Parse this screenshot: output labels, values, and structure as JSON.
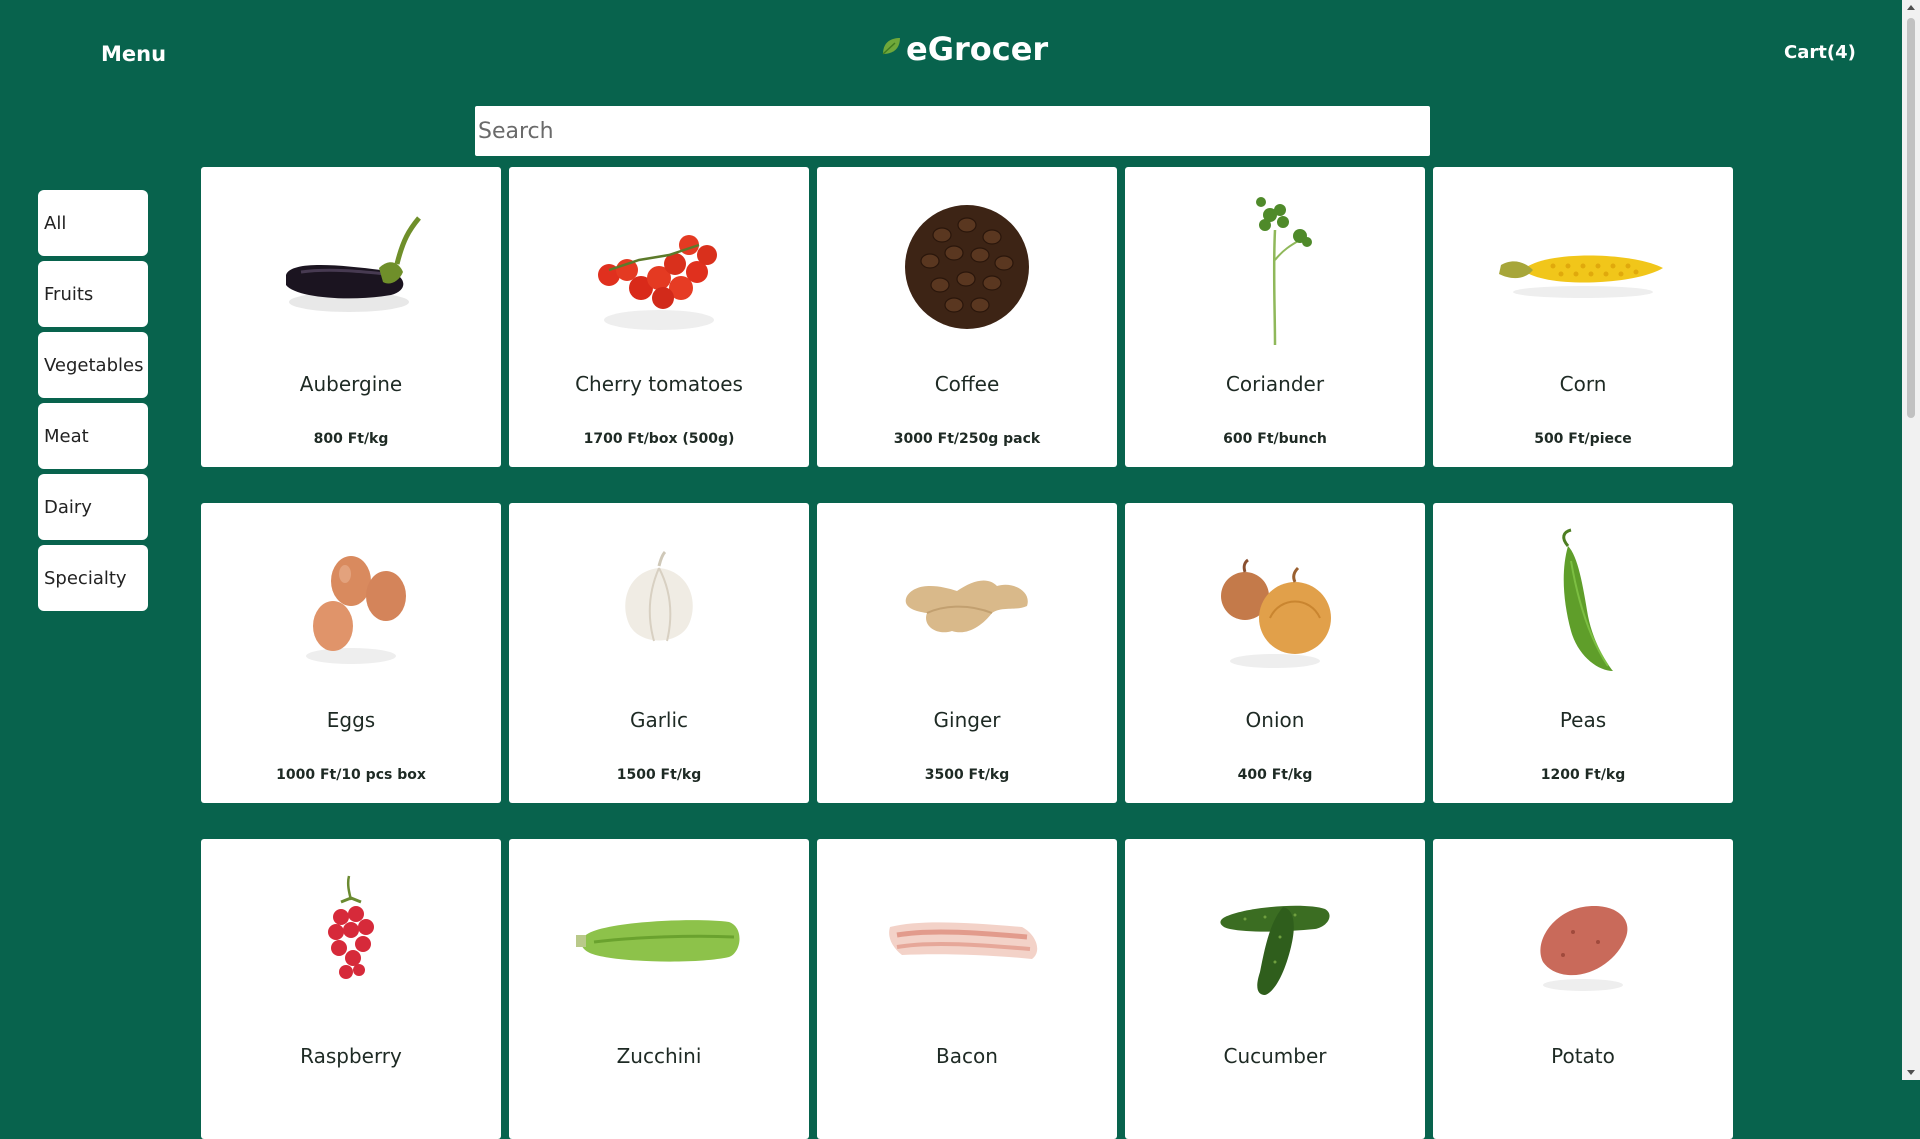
{
  "header": {
    "menu_label": "Menu",
    "logo_text": "eGrocer",
    "cart_label": "Cart(4)"
  },
  "search": {
    "placeholder": "Search",
    "value": ""
  },
  "categories": [
    "All",
    "Fruits",
    "Vegetables",
    "Meat",
    "Dairy",
    "Specialty"
  ],
  "products": [
    {
      "name": "Aubergine",
      "price": "800 Ft/kg",
      "icon": "aubergine-image"
    },
    {
      "name": "Cherry tomatoes",
      "price": "1700 Ft/box (500g)",
      "icon": "cherry-tomatoes-image"
    },
    {
      "name": "Coffee",
      "price": "3000 Ft/250g pack",
      "icon": "coffee-beans-image"
    },
    {
      "name": "Coriander",
      "price": "600 Ft/bunch",
      "icon": "coriander-image"
    },
    {
      "name": "Corn",
      "price": "500 Ft/piece",
      "icon": "corn-image"
    },
    {
      "name": "Eggs",
      "price": "1000 Ft/10 pcs box",
      "icon": "eggs-image"
    },
    {
      "name": "Garlic",
      "price": "1500 Ft/kg",
      "icon": "garlic-image"
    },
    {
      "name": "Ginger",
      "price": "3500 Ft/kg",
      "icon": "ginger-image"
    },
    {
      "name": "Onion",
      "price": "400 Ft/kg",
      "icon": "onion-image"
    },
    {
      "name": "Peas",
      "price": "1200 Ft/kg",
      "icon": "peas-image"
    },
    {
      "name": "Raspberry",
      "price": "",
      "icon": "raspberry-image"
    },
    {
      "name": "Zucchini",
      "price": "",
      "icon": "zucchini-image"
    },
    {
      "name": "Bacon",
      "price": "",
      "icon": "bacon-image"
    },
    {
      "name": "Cucumber",
      "price": "",
      "icon": "cucumber-image"
    },
    {
      "name": "Potato",
      "price": "",
      "icon": "potato-image"
    }
  ],
  "colors": {
    "background": "#08634d",
    "card": "#ffffff",
    "text": "#1e2a24"
  }
}
